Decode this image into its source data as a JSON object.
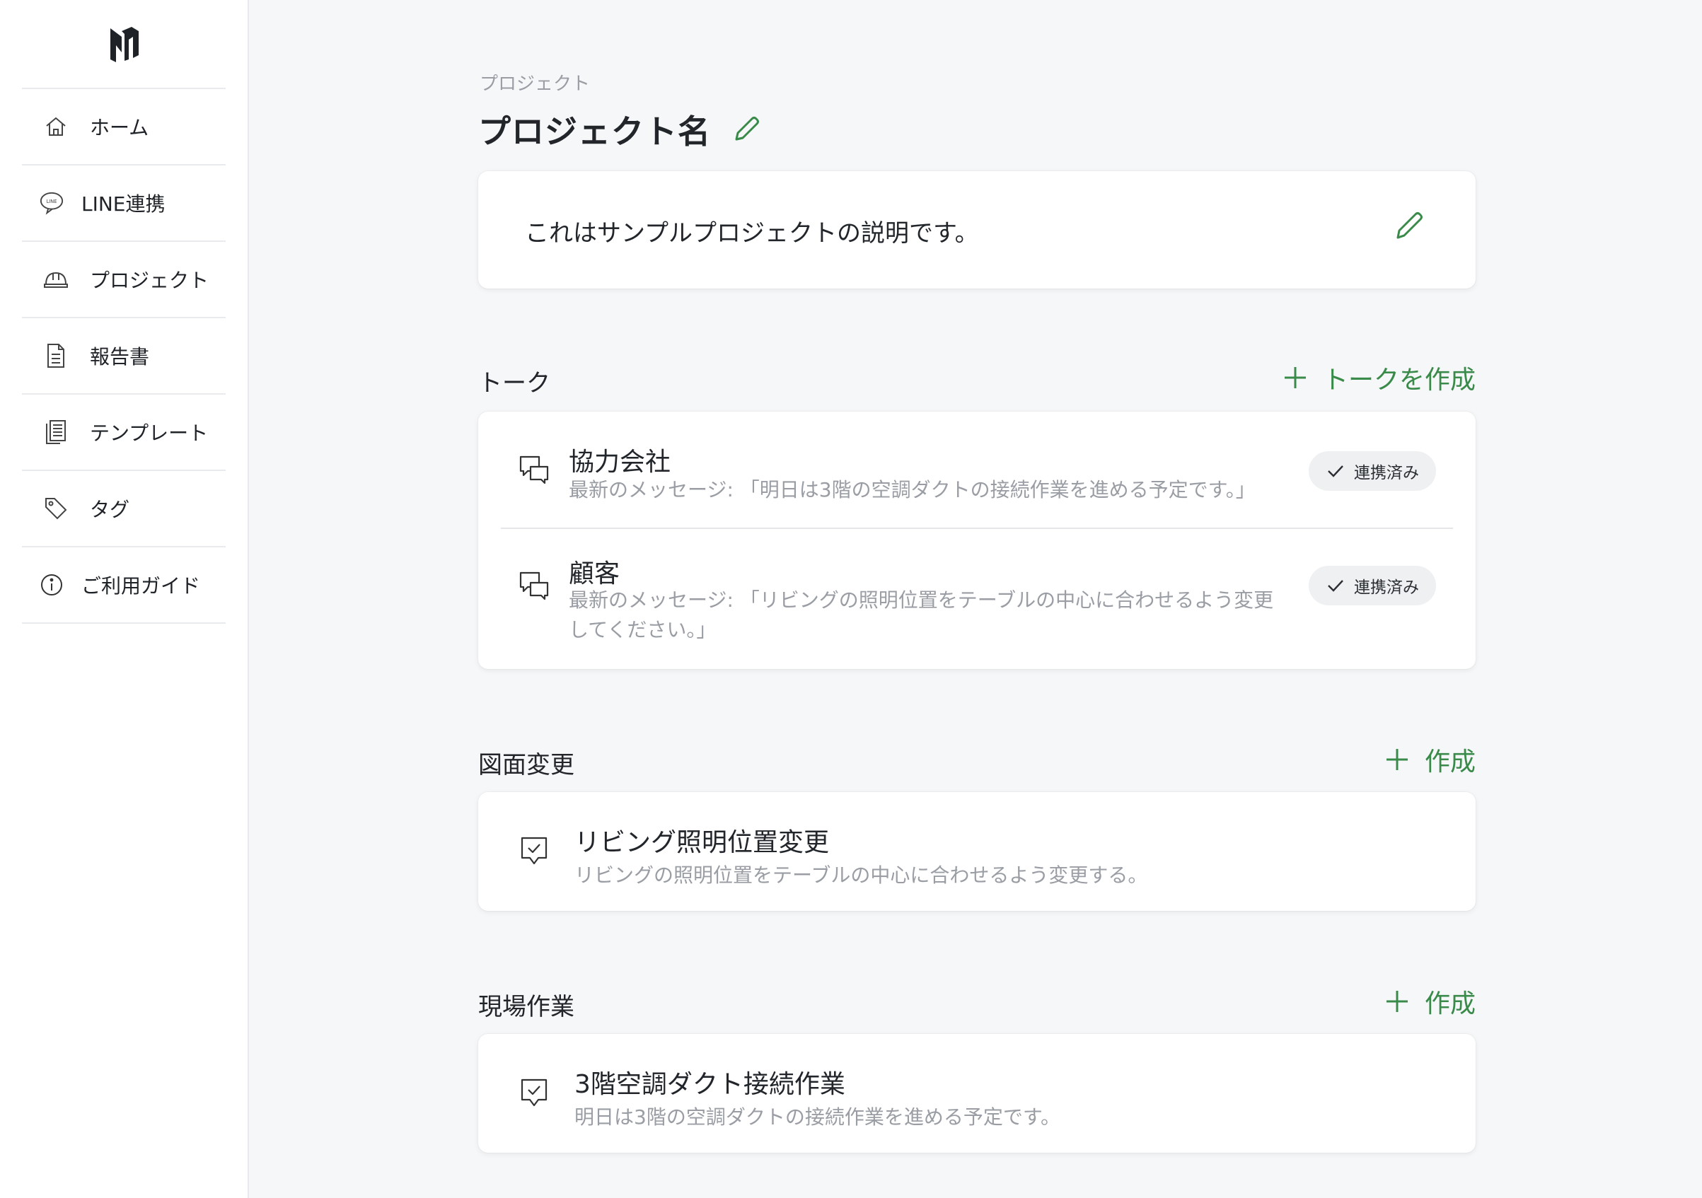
{
  "sidebar": {
    "items": [
      {
        "label": "ホーム",
        "icon": "home-icon"
      },
      {
        "label": "LINE連携",
        "icon": "line-chat-icon"
      },
      {
        "label": "プロジェクト",
        "icon": "hard-hat-icon"
      },
      {
        "label": "報告書",
        "icon": "document-icon"
      },
      {
        "label": "テンプレート",
        "icon": "template-icon"
      },
      {
        "label": "タグ",
        "icon": "tag-icon"
      },
      {
        "label": "ご利用ガイド",
        "icon": "info-icon"
      }
    ]
  },
  "header": {
    "breadcrumb": "プロジェクト",
    "title": "プロジェクト名"
  },
  "description": {
    "text": "これはサンプルプロジェクトの説明です。"
  },
  "talks": {
    "title": "トーク",
    "add_label": "トークを作成",
    "items": [
      {
        "name": "協力会社",
        "last_message": "最新のメッセージ: 「明日は3階の空調ダクトの接続作業を進める予定です。」",
        "status": "連携済み"
      },
      {
        "name": "顧客",
        "last_message_line1": "最新のメッセージ: 「リビングの照明位置をテーブルの中心に合わせるよう変更",
        "last_message_line2": "してください。」",
        "status": "連携済み"
      }
    ]
  },
  "drawing_changes": {
    "title": "図面変更",
    "add_label": "作成",
    "items": [
      {
        "name": "リビング照明位置変更",
        "detail": "リビングの照明位置をテーブルの中心に合わせるよう変更する。"
      }
    ]
  },
  "site_work": {
    "title": "現場作業",
    "add_label": "作成",
    "items": [
      {
        "name": "3階空調ダクト接続作業",
        "detail": "明日は3階の空調ダクトの接続作業を進める予定です。"
      }
    ]
  },
  "colors": {
    "accent": "#3a8a4a",
    "background": "#f6f7f9",
    "muted_text": "#9a9ea4"
  }
}
